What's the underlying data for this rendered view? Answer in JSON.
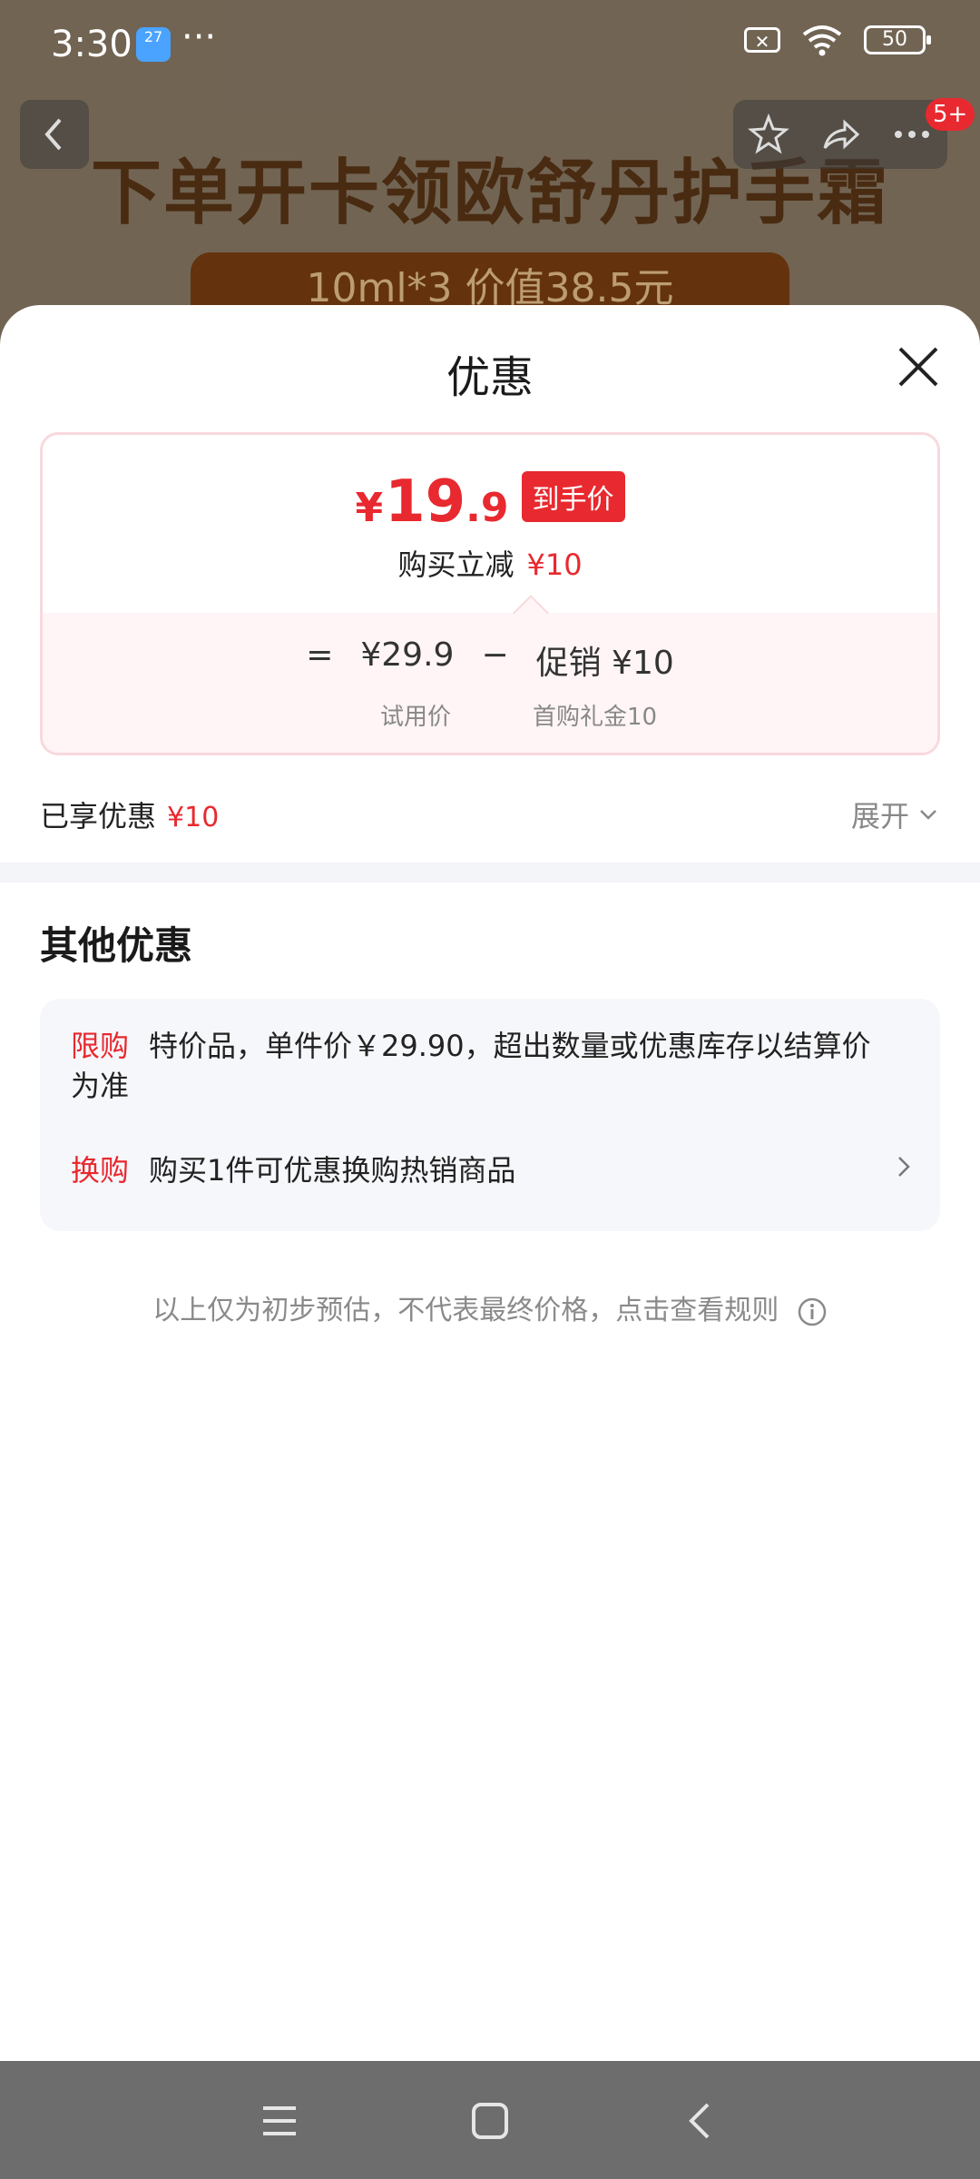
{
  "status_bar": {
    "time": "3:30",
    "weather_badge": "27",
    "more": "···",
    "battery": "50"
  },
  "background": {
    "banner_title": "下单开卡领欧舒丹护手霜",
    "banner_pill": "10ml*3  价值38.5元",
    "notification_count": "5+"
  },
  "sheet": {
    "title": "优惠",
    "price_card": {
      "currency": "¥",
      "final_int": "19",
      "final_dec": ".9",
      "final_tag": "到手价",
      "reduce_label": "购买立减",
      "reduce_value": "¥10",
      "eq": "=",
      "base_price": "¥29.9",
      "minus": "−",
      "promo_label": "促销 ¥10",
      "base_sub": "试用价",
      "promo_sub": "首购礼金10"
    },
    "enjoyed": {
      "label": "已享优惠",
      "value": "¥10",
      "expand": "展开"
    },
    "other": {
      "title": "其他优惠",
      "items": [
        {
          "tag": "限购",
          "text": "特价品，单件价￥29.90，超出数量或优惠库存以结算价为准"
        },
        {
          "tag": "换购",
          "text": "购买1件可优惠换购热销商品"
        }
      ]
    },
    "disclaimer": "以上仅为初步预估，不代表最终价格，点击查看规则"
  },
  "colors": {
    "accent_red": "#e8292f",
    "card_border": "#f8d9dd",
    "card_tint": "#fff5f6",
    "section_bg": "#f6f7fb"
  }
}
